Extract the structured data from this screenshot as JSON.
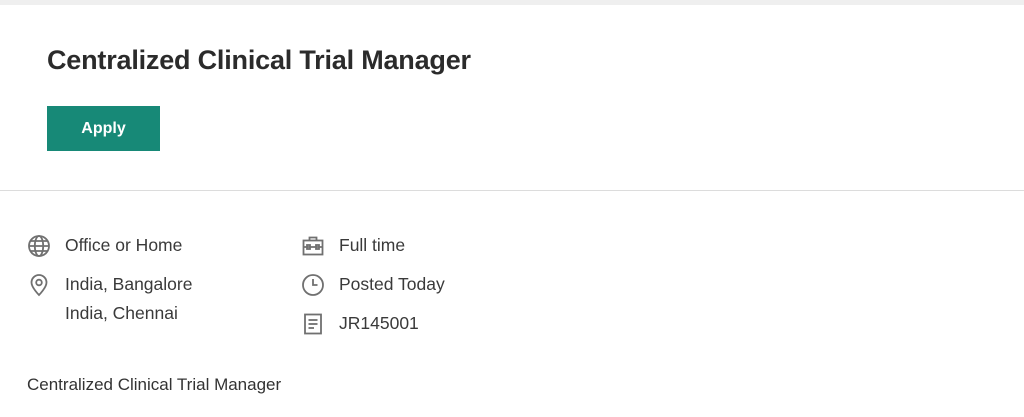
{
  "job": {
    "title": "Centralized Clinical Trial Manager",
    "apply_label": "Apply"
  },
  "details": {
    "work_mode": "Office or Home",
    "locations": [
      "India, Bangalore",
      "India, Chennai"
    ],
    "employment_type": "Full time",
    "posted": "Posted Today",
    "requisition_id": "JR145001"
  },
  "description": {
    "first_line": "Centralized Clinical Trial Manager"
  },
  "colors": {
    "accent": "#178977",
    "icon": "#707070"
  },
  "icons": {
    "work_mode": "globe-icon",
    "location": "location-pin-icon",
    "employment_type": "briefcase-icon",
    "posted": "clock-icon",
    "requisition": "document-icon"
  }
}
